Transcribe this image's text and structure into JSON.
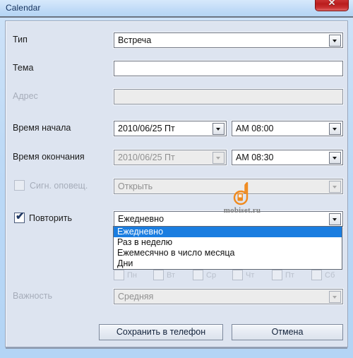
{
  "window": {
    "title": "Calendar",
    "close_glyph": "✕",
    "close_icon_name": "close-icon"
  },
  "colors": {
    "titlebar": "#bcd9f6",
    "panel": "#dde4f0",
    "close_button": "#b91d1d",
    "selection": "#1a7de0",
    "checkmark": "#1f3864",
    "watermark": "#f08a1e"
  },
  "form": {
    "rows": [
      {
        "label": "Тип",
        "name": "type",
        "value": "Встреча",
        "disabled": false,
        "has_checkbox": false,
        "has_arrow": true
      },
      {
        "label": "Тема",
        "name": "subject",
        "value": "",
        "placeholder": "",
        "disabled": false,
        "has_checkbox": false,
        "has_arrow": false
      },
      {
        "label": "Адрес",
        "name": "address",
        "value": "",
        "placeholder": "",
        "disabled": true,
        "has_checkbox": false,
        "has_arrow": false
      },
      {
        "label": "Время начала",
        "name": "start-time",
        "date_value": "2010/06/25 Пт",
        "time_value": "AM 08:00",
        "disabled": false,
        "split": true
      },
      {
        "label": "Время окончания",
        "name": "end-time",
        "date_value": "2010/06/25 Пт",
        "time_value": "AM 08:30",
        "date_disabled": true,
        "time_disabled": false,
        "split": true
      },
      {
        "label": "Сигн. оповещ.",
        "name": "alarm",
        "value": "Открыть",
        "disabled": true,
        "has_checkbox": true,
        "checked": false,
        "has_arrow": true
      },
      {
        "label": "Повторить",
        "name": "repeat",
        "value": "Ежедневно",
        "disabled": false,
        "has_checkbox": true,
        "checked": true,
        "checkmark": "✔",
        "has_arrow": true
      },
      {
        "label": "Важность",
        "name": "importance",
        "value": "Средняя",
        "disabled": true,
        "has_checkbox": false,
        "has_arrow": true
      }
    ]
  },
  "repeat_dropdown": {
    "open": true,
    "selected_index": 0,
    "options": [
      "Ежедневно",
      "Раз в неделю",
      "Ежемесячно в число месяца",
      "Дни"
    ]
  },
  "weekdays": {
    "note": "disabled weekday checkboxes, mostly occluded by open dropdown",
    "items": [
      {
        "label": "Пн",
        "checked": false
      },
      {
        "label": "Вт",
        "checked": false
      },
      {
        "label": "Ср",
        "checked": false
      },
      {
        "label": "Чт",
        "checked": false
      },
      {
        "label": "Пт",
        "checked": false
      },
      {
        "label": "Сб",
        "checked": false
      }
    ]
  },
  "buttons": {
    "save": "Сохранить в телефон",
    "cancel": "Отмена"
  },
  "watermark": {
    "text": "mobiset.ru"
  }
}
